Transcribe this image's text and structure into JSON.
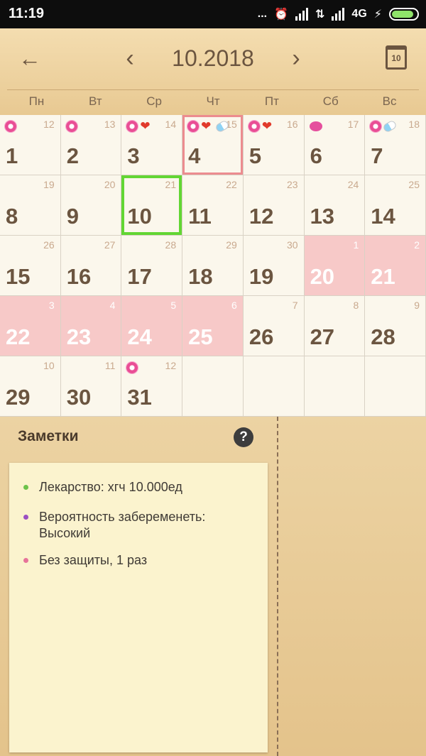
{
  "status_bar": {
    "time": "11:19",
    "dots": "...",
    "network": "4G",
    "charge": "⚡"
  },
  "header": {
    "back_icon": "←",
    "prev_icon": "‹",
    "title": "10.2018",
    "next_icon": "›",
    "today_label": "10"
  },
  "weekdays": [
    "Пн",
    "Вт",
    "Ср",
    "Чт",
    "Пт",
    "Сб",
    "Вс"
  ],
  "days": [
    {
      "day": "1",
      "cycle": "12",
      "icons": [
        "flower-icon"
      ]
    },
    {
      "day": "2",
      "cycle": "13",
      "icons": [
        "flower-icon"
      ]
    },
    {
      "day": "3",
      "cycle": "14",
      "icons": [
        "flower-icon",
        "heart-icon"
      ]
    },
    {
      "day": "4",
      "cycle": "15",
      "icons": [
        "flower-icon",
        "heart-icon",
        "pill-icon"
      ],
      "selected": "red"
    },
    {
      "day": "5",
      "cycle": "16",
      "icons": [
        "flower-icon",
        "heart-icon"
      ]
    },
    {
      "day": "6",
      "cycle": "17",
      "icons": [
        "egg-icon"
      ]
    },
    {
      "day": "7",
      "cycle": "18",
      "icons": [
        "flower-icon",
        "pill-icon"
      ]
    },
    {
      "day": "8",
      "cycle": "19",
      "icons": []
    },
    {
      "day": "9",
      "cycle": "20",
      "icons": []
    },
    {
      "day": "10",
      "cycle": "21",
      "icons": [],
      "selected": "green"
    },
    {
      "day": "11",
      "cycle": "22",
      "icons": []
    },
    {
      "day": "12",
      "cycle": "23",
      "icons": []
    },
    {
      "day": "13",
      "cycle": "24",
      "icons": []
    },
    {
      "day": "14",
      "cycle": "25",
      "icons": []
    },
    {
      "day": "15",
      "cycle": "26",
      "icons": []
    },
    {
      "day": "16",
      "cycle": "27",
      "icons": []
    },
    {
      "day": "17",
      "cycle": "28",
      "icons": []
    },
    {
      "day": "18",
      "cycle": "29",
      "icons": []
    },
    {
      "day": "19",
      "cycle": "30",
      "icons": []
    },
    {
      "day": "20",
      "cycle": "1",
      "icons": [],
      "period": true
    },
    {
      "day": "21",
      "cycle": "2",
      "icons": [],
      "period": true
    },
    {
      "day": "22",
      "cycle": "3",
      "icons": [],
      "period": true
    },
    {
      "day": "23",
      "cycle": "4",
      "icons": [],
      "period": true
    },
    {
      "day": "24",
      "cycle": "5",
      "icons": [],
      "period": true
    },
    {
      "day": "25",
      "cycle": "6",
      "icons": [],
      "period": true
    },
    {
      "day": "26",
      "cycle": "7",
      "icons": []
    },
    {
      "day": "27",
      "cycle": "8",
      "icons": []
    },
    {
      "day": "28",
      "cycle": "9",
      "icons": []
    },
    {
      "day": "29",
      "cycle": "10",
      "icons": []
    },
    {
      "day": "30",
      "cycle": "11",
      "icons": []
    },
    {
      "day": "31",
      "cycle": "12",
      "icons": [
        "flower-icon"
      ]
    }
  ],
  "notes": {
    "title": "Заметки",
    "help_icon": "?",
    "items": [
      {
        "text": "Лекарство:  хгч 10.000ед",
        "color": "#6cc24a"
      },
      {
        "text": "Вероятность забеременеть: Высокий",
        "color": "#9b4fc2"
      },
      {
        "text": "Без защиты, 1 раз",
        "color": "#e7739a"
      }
    ]
  },
  "colors": {
    "period": "#f7c9c8",
    "selected_today": "#62d633",
    "selected_red": "#ec8c8f",
    "text_brown": "#6b5540"
  }
}
